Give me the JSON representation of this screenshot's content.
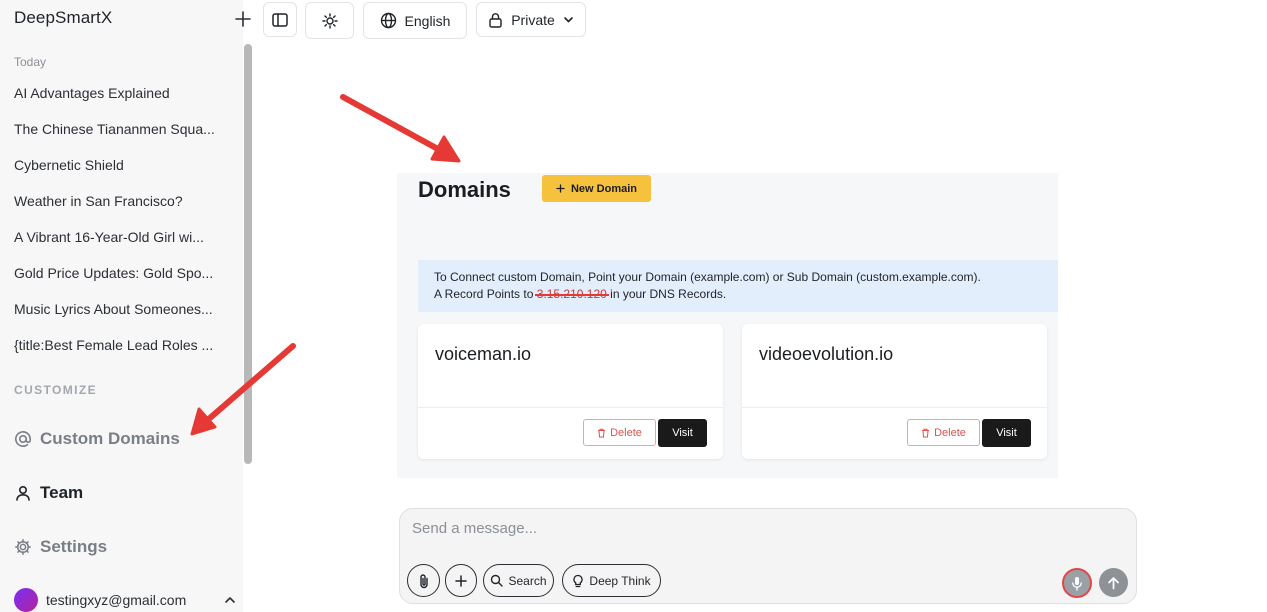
{
  "sidebar": {
    "brand": "DeepSmartX",
    "section_today": "Today",
    "conversations": [
      "AI Advantages Explained",
      "The Chinese Tiananmen Squa...",
      "Cybernetic Shield",
      "Weather in San Francisco?",
      "A Vibrant 16-Year-Old Girl wi...",
      "Gold Price Updates: Gold Spo...",
      "Music Lyrics About Someones...",
      "{title:Best Female Lead Roles ..."
    ],
    "section_customize": "CUSTOMIZE",
    "nav": {
      "custom_domains": "Custom Domains",
      "team": "Team",
      "settings": "Settings"
    },
    "user_email": "testingxyz@gmail.com"
  },
  "toolbar": {
    "language": "English",
    "privacy": "Private"
  },
  "domains": {
    "title": "Domains",
    "new_domain_label": "New Domain",
    "notice_line1": "To Connect custom Domain, Point your Domain (example.com) or Sub Domain (custom.example.com).",
    "notice_line2_prefix": "A Record Points to",
    "notice_ip": "3.15.210.120",
    "notice_line2_suffix": "in your DNS Records.",
    "cards": [
      {
        "name": "voiceman.io",
        "delete_label": "Delete",
        "visit_label": "Visit"
      },
      {
        "name": "videoevolution.io",
        "delete_label": "Delete",
        "visit_label": "Visit"
      }
    ]
  },
  "composer": {
    "placeholder": "Send a message...",
    "search_label": "Search",
    "deep_think_label": "Deep Think"
  },
  "colors": {
    "accent_yellow": "#f6c23e",
    "annotation_red": "#e53935",
    "notice_blue": "#e3eefc"
  }
}
